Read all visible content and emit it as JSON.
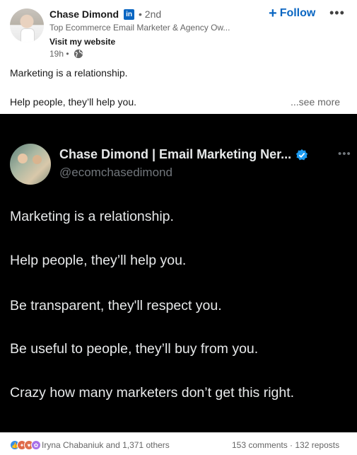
{
  "post": {
    "author_name": "Chase Dimond",
    "linkedin_badge": "in",
    "degree": "• 2nd",
    "headline": "Top Ecommerce Email Marketer & Agency Ow...",
    "visit_link": "Visit my website",
    "time": "19h •",
    "follow_label": "Follow",
    "follow_plus": "+",
    "menu": "•••",
    "text_line_1": "Marketing is a relationship.",
    "text_line_2": "Help people, they’ll help you.",
    "see_more": "...see more"
  },
  "tweet": {
    "name": "Chase Dimond | Email Marketing Ner...",
    "handle": "@ecomchasedimond",
    "menu": "•••",
    "lines": [
      "Marketing is a relationship.",
      "Help people, they’ll help you.",
      "Be transparent, they'll respect you.",
      "Be useful to people, they’ll buy from you.",
      "Crazy how many marketers don’t get this right."
    ]
  },
  "social": {
    "reactions_text": "Iryna Chabaniuk and 1,371 others",
    "counts_text": "153 comments · 132 reposts"
  },
  "icons": {
    "globe": "globe-icon",
    "verified": "verified-badge-icon",
    "reactions": [
      "like-icon",
      "celebrate-icon",
      "love-icon",
      "support-icon"
    ]
  },
  "colors": {
    "linkedin_blue": "#0a66c2",
    "tweet_background": "#000000",
    "verified_blue": "#1d9bf0"
  }
}
